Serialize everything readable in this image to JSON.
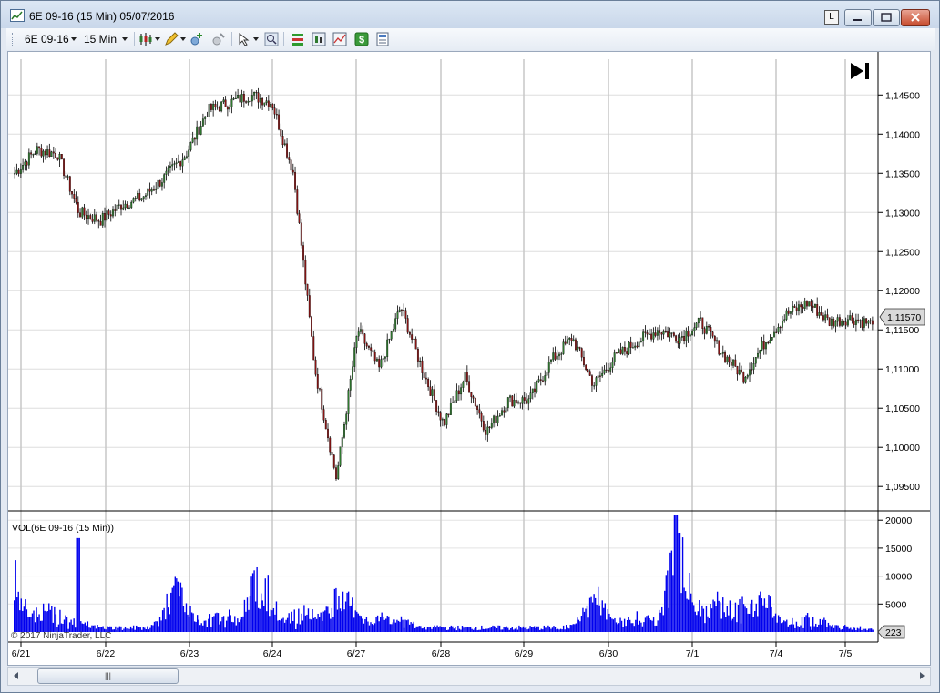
{
  "window": {
    "title": "6E 09-16 (15 Min)  05/07/2016",
    "lock_label": "L"
  },
  "toolbar": {
    "instrument": "6E 09-16",
    "interval": "15 Min",
    "icons": [
      "chart-style-icon",
      "draw-pencil-icon",
      "add-indicator-icon",
      "strategies-icon",
      "pointer-icon",
      "zoom-icon",
      "data-box-icon",
      "chart-trader-icon",
      "bar-chart-icon",
      "dollar-icon",
      "properties-icon"
    ]
  },
  "price_panel": {
    "current_price_label": "1,11570",
    "last_price": 1.1157,
    "ylim": [
      1.092,
      1.1505
    ],
    "y_ticks": [
      "1,09500",
      "1,10000",
      "1,10500",
      "1,11000",
      "1,11500",
      "1,12000",
      "1,12500",
      "1,13000",
      "1,13500",
      "1,14000",
      "1,14500"
    ],
    "colors": {
      "up": "#2f7a2f",
      "down": "#8a1414",
      "wick": "#000000",
      "grid": "#dddddd"
    }
  },
  "volume_panel": {
    "title": "VOL(6E 09-16 (15 Min))",
    "current_volume_label": "223",
    "ylim": [
      0,
      21500
    ],
    "y_ticks": [
      "20000",
      "15000",
      "10000",
      "5000"
    ],
    "bar_color": "#0000ee"
  },
  "x_axis": {
    "labels": [
      "6/21",
      "6/22",
      "6/23",
      "6/24",
      "6/27",
      "6/28",
      "6/29",
      "6/30",
      "7/1",
      "7/4",
      "7/5"
    ]
  },
  "copyright": "© 2017 NinjaTrader, LLC",
  "chart_data": {
    "type": "candlestick",
    "title": "6E 09-16 (15 Min)",
    "sessions": [
      "6/21",
      "6/22",
      "6/23",
      "6/24",
      "6/27",
      "6/28",
      "6/29",
      "6/30",
      "7/1",
      "7/4",
      "7/5"
    ],
    "price_path": [
      [
        "6/21",
        1.135
      ],
      [
        "6/21",
        1.138
      ],
      [
        "6/21",
        1.1375
      ],
      [
        "6/22",
        1.13
      ],
      [
        "6/22",
        1.129
      ],
      [
        "6/22",
        1.131
      ],
      [
        "6/23",
        1.132
      ],
      [
        "6/23",
        1.1345
      ],
      [
        "6/23",
        1.1375
      ],
      [
        "6/23",
        1.143
      ],
      [
        "6/23",
        1.144
      ],
      [
        "6/23",
        1.145
      ],
      [
        "6/24",
        1.144
      ],
      [
        "6/24",
        1.135
      ],
      [
        "6/24",
        1.11
      ],
      [
        "6/24",
        1.096
      ],
      [
        "6/24",
        1.115
      ],
      [
        "6/24",
        1.11
      ],
      [
        "6/24",
        1.118
      ],
      [
        "6/27",
        1.11
      ],
      [
        "6/27",
        1.103
      ],
      [
        "6/27",
        1.109
      ],
      [
        "6/27",
        1.102
      ],
      [
        "6/27",
        1.106
      ],
      [
        "6/28",
        1.106
      ],
      [
        "6/28",
        1.111
      ],
      [
        "6/28",
        1.114
      ],
      [
        "6/29",
        1.108
      ],
      [
        "6/29",
        1.1115
      ],
      [
        "6/29",
        1.1135
      ],
      [
        "6/30",
        1.115
      ],
      [
        "6/30",
        1.114
      ],
      [
        "6/30",
        1.116
      ],
      [
        "7/1",
        1.112
      ],
      [
        "7/1",
        1.109
      ],
      [
        "7/1",
        1.1135
      ],
      [
        "7/4",
        1.117
      ],
      [
        "7/4",
        1.1185
      ],
      [
        "7/4",
        1.116
      ],
      [
        "7/5",
        1.1165
      ],
      [
        "7/5",
        1.1157
      ]
    ],
    "volume_spikes": [
      [
        "6/21",
        16800
      ],
      [
        "6/23",
        9500
      ],
      [
        "6/24",
        13200
      ],
      [
        "6/27",
        9000
      ],
      [
        "6/30",
        8000
      ],
      [
        "7/1",
        21000
      ],
      [
        "7/4",
        7500
      ]
    ]
  }
}
